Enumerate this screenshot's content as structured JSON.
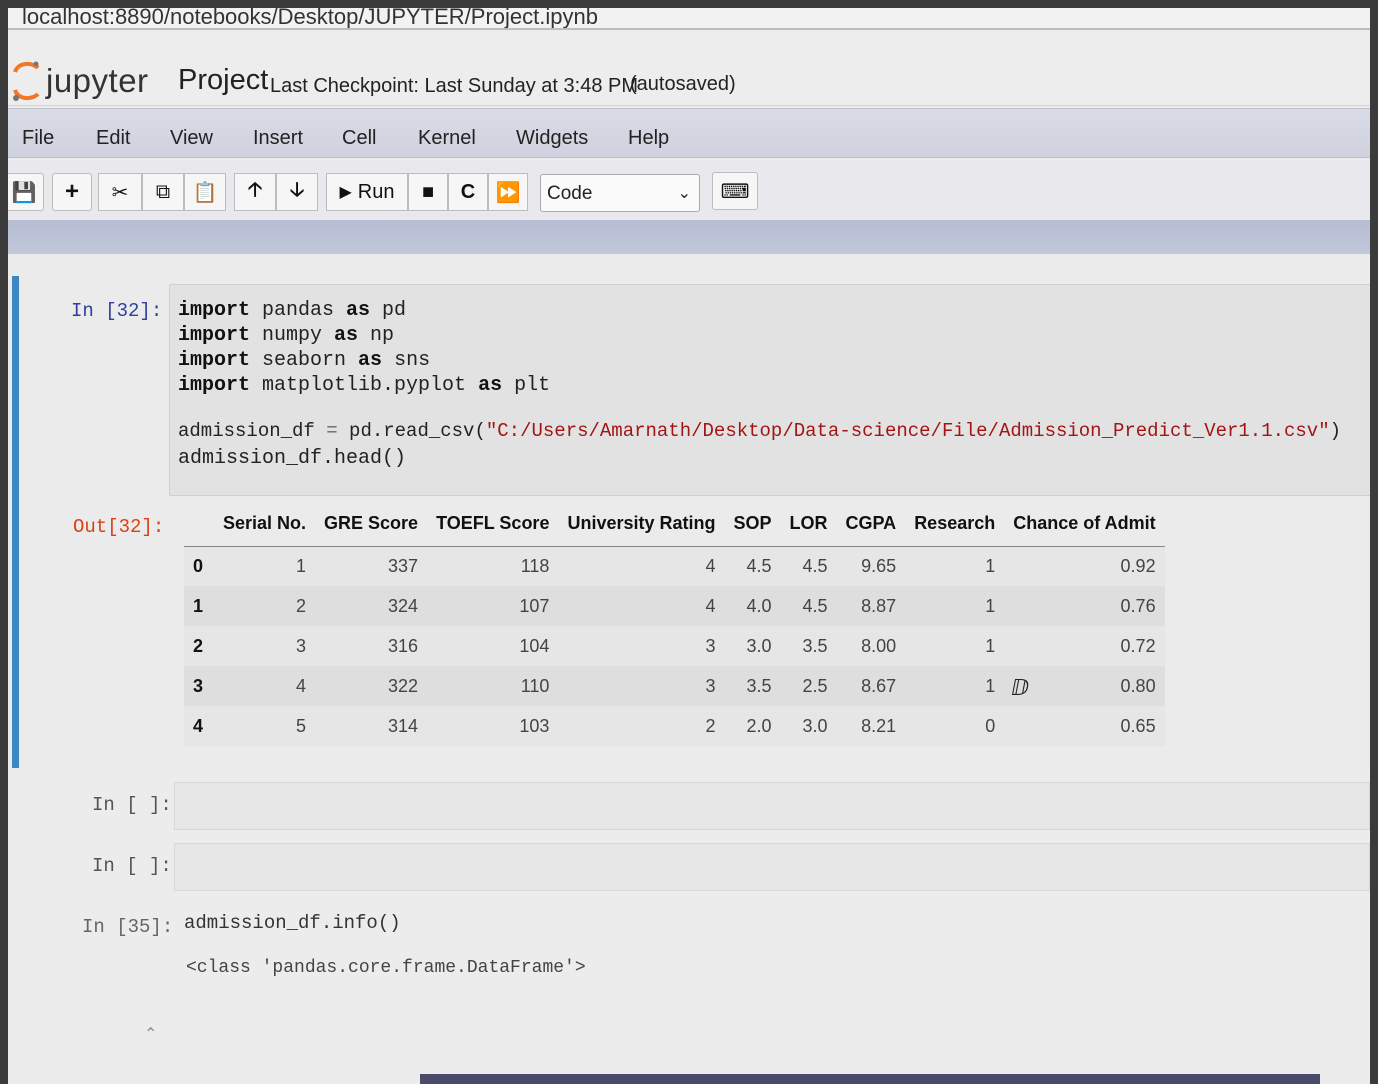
{
  "browser": {
    "url": "localhost:8890/notebooks/Desktop/JUPYTER/Project.ipynb"
  },
  "header": {
    "logo_text": "jupyter",
    "notebook_title": "Project",
    "checkpoint": "Last Checkpoint: Last Sunday at 3:48 PM",
    "autosave_status": "(autosaved)"
  },
  "menu": [
    "File",
    "Edit",
    "View",
    "Insert",
    "Cell",
    "Kernel",
    "Widgets",
    "Help"
  ],
  "toolbar": {
    "icons": [
      "save-icon",
      "plus-icon",
      "scissors-icon",
      "copy-icon",
      "paste-icon",
      "arrow-up-icon",
      "arrow-down-icon",
      "play-icon",
      "stop-icon",
      "restart-icon",
      "fast-forward-icon",
      "keyboard-icon"
    ],
    "run_label": "Run",
    "cell_type": "Code"
  },
  "cells": {
    "cell1": {
      "in_prompt": "In [32]:",
      "out_prompt": "Out[32]:",
      "code": {
        "l1_kw1": "import",
        "l1_rest": " pandas ",
        "l1_kw2": "as",
        "l1_alias": " pd",
        "l2_kw1": "import",
        "l2_rest": " numpy ",
        "l2_kw2": "as",
        "l2_alias": " np",
        "l3_kw1": "import",
        "l3_rest": " seaborn ",
        "l3_kw2": "as",
        "l3_alias": " sns",
        "l4_kw1": "import",
        "l4_rest": " matplotlib.pyplot ",
        "l4_kw2": "as",
        "l4_alias": " plt",
        "l5_var": "admission_df ",
        "l5_eq": "=",
        "l5_call": " pd.read_csv(",
        "l5_str": "\"C:/Users/Amarnath/Desktop/Data-science/File/Admission_Predict_Ver1.1.csv\"",
        "l5_close": ")",
        "l6": "admission_df.head()"
      },
      "table": {
        "columns": [
          "",
          "Serial No.",
          "GRE Score",
          "TOEFL Score",
          "University Rating",
          "SOP",
          "LOR",
          "CGPA",
          "Research",
          "Chance of Admit"
        ],
        "rows": [
          [
            "0",
            "1",
            "337",
            "118",
            "4",
            "4.5",
            "4.5",
            "9.65",
            "1",
            "0.92"
          ],
          [
            "1",
            "2",
            "324",
            "107",
            "4",
            "4.0",
            "4.5",
            "8.87",
            "1",
            "0.76"
          ],
          [
            "2",
            "3",
            "316",
            "104",
            "3",
            "3.0",
            "3.5",
            "8.00",
            "1",
            "0.72"
          ],
          [
            "3",
            "4",
            "322",
            "110",
            "3",
            "3.5",
            "2.5",
            "8.67",
            "1",
            "0.80"
          ],
          [
            "4",
            "5",
            "314",
            "103",
            "2",
            "2.0",
            "3.0",
            "8.21",
            "0",
            "0.65"
          ]
        ]
      }
    },
    "cell2": {
      "in_prompt": "In [ ]:"
    },
    "cell3": {
      "in_prompt": "In [ ]:"
    },
    "cell4": {
      "in_prompt": "In [35]:",
      "code": "admission_df.info()",
      "output": "<class 'pandas.core.frame.DataFrame'>"
    }
  },
  "colors": {
    "cell_selected_border": "#3f86c4",
    "in_prompt": "#303f9f",
    "out_prompt": "#d84315",
    "string": "#a31515"
  }
}
